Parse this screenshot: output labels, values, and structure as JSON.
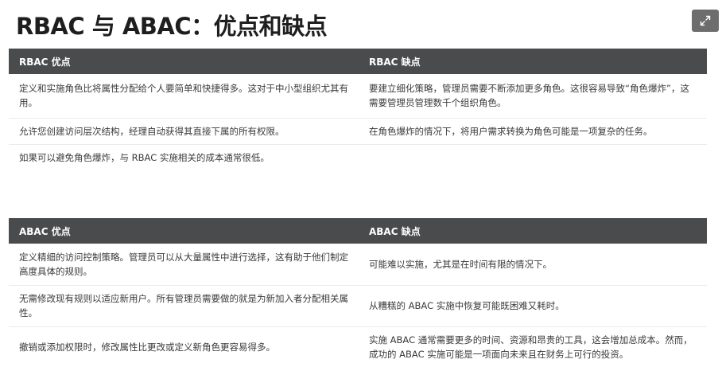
{
  "page": {
    "title": "RBAC 与 ABAC：优点和缺点",
    "expand_icon": "expand-icon"
  },
  "rbac": {
    "headers": {
      "pros": "RBAC 优点",
      "cons": "RBAC 缺点"
    },
    "rows": [
      {
        "pros": "定义和实施角色比将属性分配给个人要简单和快捷得多。这对于中小型组织尤其有用。",
        "cons": "要建立细化策略，管理员需要不断添加更多角色。这很容易导致“角色爆炸”，这需要管理员管理数千个组织角色。"
      },
      {
        "pros": "允许您创建访问层次结构，经理自动获得其直接下属的所有权限。",
        "cons": "在角色爆炸的情况下，将用户需求转换为角色可能是一项复杂的任务。"
      },
      {
        "pros": "如果可以避免角色爆炸，与 RBAC 实施相关的成本通常很低。",
        "cons": ""
      }
    ]
  },
  "abac": {
    "headers": {
      "pros": "ABAC 优点",
      "cons": "ABAC 缺点"
    },
    "rows": [
      {
        "pros": "定义精细的访问控制策略。管理员可以从大量属性中进行选择，这有助于他们制定高度具体的规则。",
        "cons": "可能难以实施，尤其是在时间有限的情况下。"
      },
      {
        "pros": "无需修改现有规则以适应新用户。所有管理员需要做的就是为新加入者分配相关属性。",
        "cons": "从糟糕的 ABAC 实施中恢复可能既困难又耗时。"
      },
      {
        "pros": "撤销或添加权限时，修改属性比更改或定义新角色更容易得多。",
        "cons": "实施 ABAC 通常需要更多的时间、资源和昂贵的工具，这会增加总成本。然而，成功的 ABAC 实施可能是一项面向未来且在财务上可行的投资。"
      }
    ]
  }
}
